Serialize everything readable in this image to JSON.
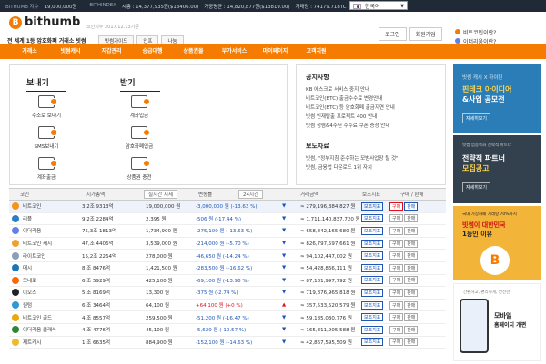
{
  "topbar": {
    "label1": "BITHUMB 지수",
    "val1": "19,000,000원",
    "label2": "BITHINDEX",
    "val2": "시총 : 14,377,935원($13406.00)",
    "val3": "가중평균 : 14,820,877원($13819.00)",
    "val4": "거래량 : 74179.718TC",
    "lang": "한국어"
  },
  "logo": {
    "word": "bithumb",
    "date": "코인지수 2017.12.13기준"
  },
  "slogan": "전 세계 1등 암호화폐 거래소 빗썸",
  "hbtns": [
    "빗썸가이드",
    "인프",
    "나눔"
  ],
  "auth": {
    "login": "로그인",
    "signup": "회원가입"
  },
  "sidelinks": [
    "비트코인이란?",
    "이더리움이란?"
  ],
  "nav": [
    "거래소",
    "빗썸캐시",
    "지갑관리",
    "승급대행",
    "상품권몰",
    "부가서비스",
    "마이페이지",
    "고객지원"
  ],
  "send": {
    "title": "보내기",
    "items": [
      "주소로 보내기",
      "SMS보내기",
      "계좌출금"
    ]
  },
  "receive": {
    "title": "받기",
    "items": [
      "계좌입금",
      "암호화폐입금",
      "상품권 충전"
    ]
  },
  "cs": {
    "line1": "고객센터",
    "line2": "1661",
    "line3": "5566"
  },
  "notice": {
    "title1": "공지사항",
    "items1": [
      "KB 에스크로 서비스 중지 안내",
      "비트코인(BTC) 출금수수료 변경안내",
      "비트코인(BTC) 등 암호화폐 출금지연 안내",
      "빗썸 인재탈출 프로젝트 400 안내",
      "빗썸 청렴&4주년 수수료 쿠폰 증정 안내"
    ],
    "title2": "보도자료",
    "items2": [
      "빗썸, \"정부지침 준수하는 모범사업장 될 것\"",
      "빗썸, 금융업 다운로드 1위 자치"
    ]
  },
  "table": {
    "headers": [
      "코인",
      "시가총액",
      "실시간 시세",
      "변동률",
      "24시간",
      "거래금액",
      "보조지표",
      "구매 / 판매"
    ],
    "rows": [
      {
        "name": "비트코인",
        "cap": "3,2조 9313억",
        "price": "19,000,000 원",
        "chg": "-3,000,000 원 (-13.63 %)",
        "vol": "≈ 279,196,384,827 원",
        "tag": "보조지표",
        "buy": "구매",
        "sell": "판매",
        "dir": "down",
        "color": "#f7931a"
      },
      {
        "name": "리플",
        "cap": "9,2조 2284억",
        "price": "2,395 원",
        "chg": "-506 원 (-17.44 %)",
        "vol": "≈ 1,711,140,837,720 원",
        "tag": "보조지표",
        "buy": "구매",
        "sell": "판매",
        "dir": "down",
        "color": "#2a7ec6"
      },
      {
        "name": "이더리움",
        "cap": "75,3조 1813억",
        "price": "1,734,900 원",
        "chg": "-275,100 원 (-13.63 %)",
        "vol": "≈ 658,842,165,680 원",
        "tag": "보조지표",
        "buy": "구매",
        "sell": "판매",
        "dir": "down",
        "color": "#627eea"
      },
      {
        "name": "비트코인 캐시",
        "cap": "47,조 4406억",
        "price": "3,539,000 원",
        "chg": "-214,000 원 (-5.70 %)",
        "vol": "≈ 826,797,597,661 원",
        "tag": "보조지표",
        "buy": "구매",
        "sell": "판매",
        "dir": "down",
        "color": "#f0a030"
      },
      {
        "name": "라이트코인",
        "cap": "15,2조 2264억",
        "price": "278,000 원",
        "chg": "-46,650 원 (-14.24 %)",
        "vol": "≈ 94,102,447,002 원",
        "tag": "보조지표",
        "buy": "구매",
        "sell": "판매",
        "dir": "down",
        "color": "#8aa0b8"
      },
      {
        "name": "대시",
        "cap": "8,조 8476억",
        "price": "1,421,500 원",
        "chg": "-283,500 원 (-16.62 %)",
        "vol": "≈ 54,428,866,111 원",
        "tag": "보조지표",
        "buy": "구매",
        "sell": "판매",
        "dir": "down",
        "color": "#1c75bc"
      },
      {
        "name": "모네로",
        "cap": "6,조 5929억",
        "price": "425,100 원",
        "chg": "-69,100 원 (-13.98 %)",
        "vol": "≈ 87,181,997,792 원",
        "tag": "보조지표",
        "buy": "구매",
        "sell": "판매",
        "dir": "down",
        "color": "#ff6600"
      },
      {
        "name": "이오스",
        "cap": "5,조 8169억",
        "price": "13,300 원",
        "chg": "-375 원 (-2.74 %)",
        "vol": "≈ 719,876,965,818 원",
        "tag": "보조지표",
        "buy": "구매",
        "sell": "판매",
        "dir": "down",
        "color": "#222222"
      },
      {
        "name": "퀀텀",
        "cap": "6,조 3464억",
        "price": "64,100 원",
        "chg": "+64,100 원 (+0 %)",
        "vol": "≈ 357,533,520,579 원",
        "tag": "보조지표",
        "buy": "구매",
        "sell": "판매",
        "dir": "up",
        "color": "#2e9ad0"
      },
      {
        "name": "비트코인 골드",
        "cap": "4,조 8557억",
        "price": "259,500 원",
        "chg": "-51,200 원 (-16.47 %)",
        "vol": "≈ 59,185,030,776 원",
        "tag": "보조지표",
        "buy": "구매",
        "sell": "판매",
        "dir": "down",
        "color": "#eba809"
      },
      {
        "name": "이더리움 클래식",
        "cap": "4,조 4776억",
        "price": "45,100 원",
        "chg": "-5,620 원 (-10.57 %)",
        "vol": "≈ 165,811,905,588 원",
        "tag": "보조지표",
        "buy": "구매",
        "sell": "판매",
        "dir": "down",
        "color": "#328332"
      },
      {
        "name": "제트캐시",
        "cap": "1,조 6635억",
        "price": "884,900 원",
        "chg": "-152,100 원 (-14.63 %)",
        "vol": "≈ 42,867,595,509 원",
        "tag": "보조지표",
        "buy": "구매",
        "sell": "판매",
        "dir": "down",
        "color": "#f4b728"
      }
    ]
  },
  "ads": [
    {
      "t1": "빗썸 캐시 X 하이틴",
      "t2": "핀테크 아이디어",
      "t2b": "&사업 공모전",
      "btn": "자세히보기",
      "bg": "#2b7db8"
    },
    {
      "t1": "빗썸 업종특화 전략적 파트너",
      "t2": "전략적 파트너",
      "t2b": "모집공고",
      "btn": "자세히보기",
      "bg": "#33404d"
    },
    {
      "t1": "국내 가상화폐 거래량 70%차지",
      "t2": "빗썸이 대한민국",
      "t2b": "1등인 이유",
      "btn": "",
      "bg": "#f3b43a"
    },
    {
      "t1": "간편하고, 편리하게, 안전한",
      "t2": "모바일",
      "t2b": "홈페이지 개편",
      "btn": "",
      "bg": "#ffffff"
    }
  ]
}
